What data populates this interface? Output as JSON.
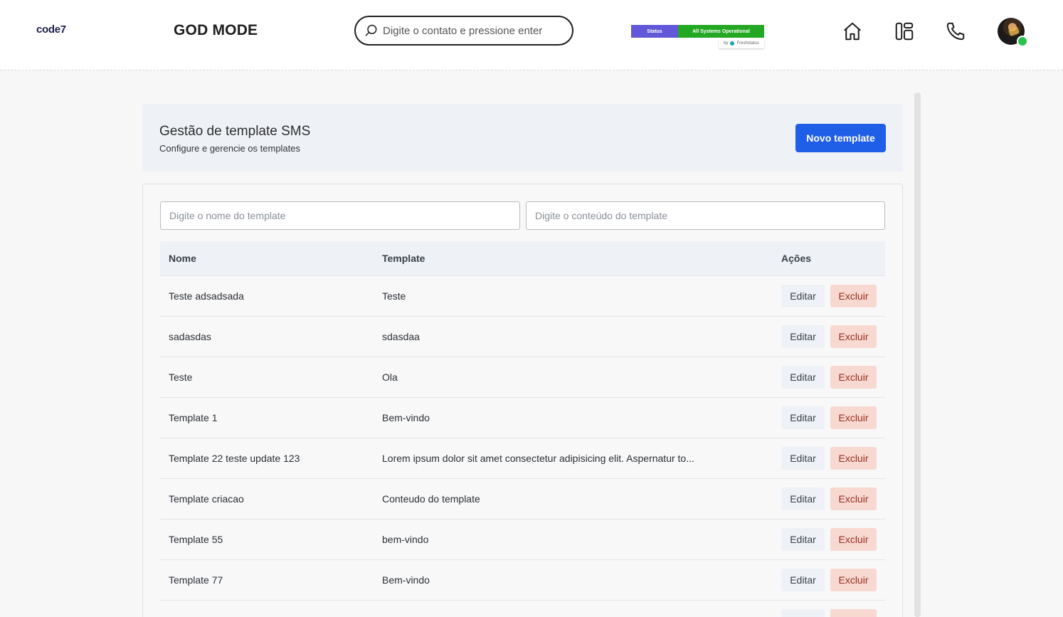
{
  "header": {
    "logo": "code7",
    "title": "GOD MODE",
    "search_placeholder": "Digite o contato e pressione enter",
    "status_label": "Status",
    "status_value": "All Systems Operational",
    "status_by": "by",
    "status_provider": "Freshstatus",
    "colors": {
      "status_left": "#6257d9",
      "status_right": "#23a823",
      "presence": "#29c24a"
    }
  },
  "page": {
    "title": "Gestão de template SMS",
    "subtitle": "Configure e gerencie os templates",
    "new_button": "Novo template",
    "filter_name_placeholder": "Digite o nome do template",
    "filter_content_placeholder": "Digite o conteúdo do template",
    "columns": {
      "name": "Nome",
      "template": "Template",
      "actions": "Ações"
    },
    "edit_label": "Editar",
    "delete_label": "Excluir",
    "rows": [
      {
        "name": "Teste adsadsada",
        "template": "Teste"
      },
      {
        "name": "sadasdas",
        "template": "sdasdaa"
      },
      {
        "name": "Teste",
        "template": "Ola"
      },
      {
        "name": "Template 1",
        "template": "Bem-vindo"
      },
      {
        "name": "Template 22 teste update 123",
        "template": "Lorem ipsum dolor sit amet consectetur adipisicing elit. Aspernatur to..."
      },
      {
        "name": "Template criacao",
        "template": "Conteudo do template"
      },
      {
        "name": "Template 55",
        "template": "bem-vindo"
      },
      {
        "name": "Template 77",
        "template": "Bem-vindo"
      }
    ],
    "accent_color": "#1f5ee6"
  }
}
